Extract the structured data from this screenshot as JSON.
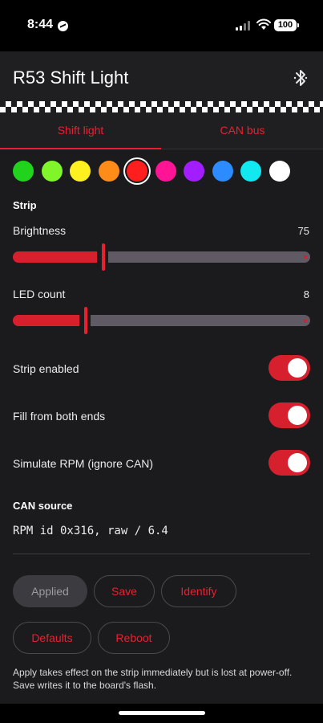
{
  "status_bar": {
    "time": "8:44",
    "battery": "100",
    "icons": [
      "messenger-icon",
      "cellular-signal-icon",
      "wifi-icon",
      "battery-icon"
    ]
  },
  "app_bar": {
    "title": "R53 Shift Light",
    "icon": "bluetooth-icon"
  },
  "tabs": [
    {
      "label": "Shift light",
      "active": true
    },
    {
      "label": "CAN bus",
      "active": false
    }
  ],
  "colors": {
    "accent": "#e8202f",
    "background": "#1b1b1d",
    "app_bar": "#1f1f22",
    "slider_inactive": "#5f5a63",
    "swatches": [
      "#22d31d",
      "#7ff52a",
      "#fff01f",
      "#ff8c19",
      "#ff1e1e",
      "#ff1496",
      "#a21dff",
      "#2b8bff",
      "#11e8ef",
      "#ffffff"
    ],
    "selected_swatch_index": 4
  },
  "strip": {
    "title": "Strip",
    "brightness": {
      "label": "Brightness",
      "value": "75",
      "fraction": 0.3
    },
    "led_count": {
      "label": "LED count",
      "value": "8",
      "fraction": 0.24
    }
  },
  "toggles": [
    {
      "label": "Strip enabled",
      "on": true
    },
    {
      "label": "Fill from both ends",
      "on": true
    },
    {
      "label": "Simulate RPM (ignore CAN)",
      "on": true
    }
  ],
  "can_source": {
    "title": "CAN source",
    "text": "RPM id 0x316, raw / 6.4"
  },
  "buttons": {
    "applied": "Applied",
    "save": "Save",
    "identify": "Identify",
    "defaults": "Defaults",
    "reboot": "Reboot"
  },
  "help_text": "Apply takes effect on the strip immediately but is lost at power-off. Save writes it to the board's flash."
}
